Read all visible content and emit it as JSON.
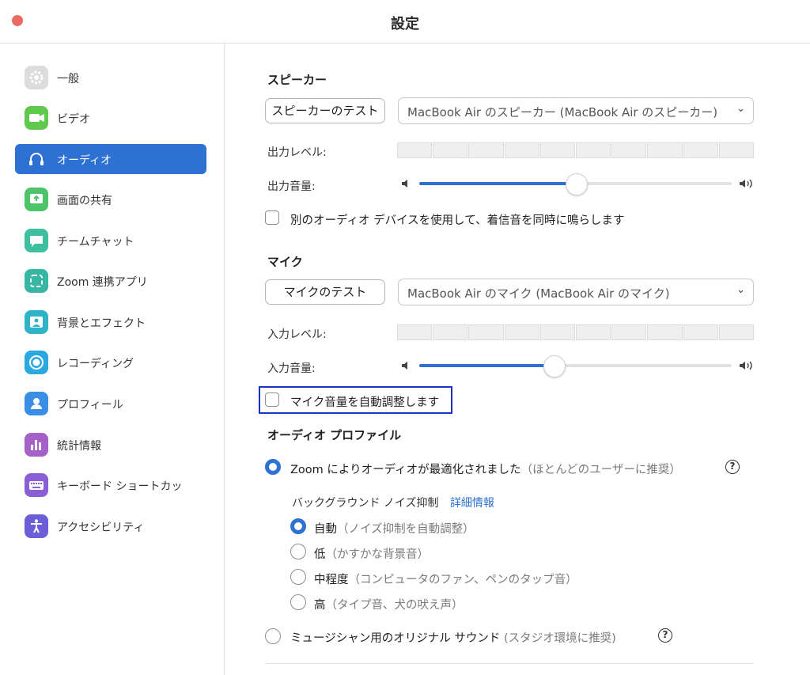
{
  "window": {
    "title": "設定"
  },
  "sidebar": {
    "items": [
      {
        "label": "一般",
        "icon": "gear-icon",
        "color": "#dcdcdc",
        "active": false
      },
      {
        "label": "ビデオ",
        "icon": "video-camera-icon",
        "color": "#5fc94d",
        "active": false
      },
      {
        "label": "オーディオ",
        "icon": "headphones-icon",
        "color": "#2d71d2",
        "active": true
      },
      {
        "label": "画面の共有",
        "icon": "screen-share-icon",
        "color": "#4ec46a",
        "active": false
      },
      {
        "label": "チームチャット",
        "icon": "chat-bubble-icon",
        "color": "#3dbfa0",
        "active": false
      },
      {
        "label": "Zoom 連携アプリ",
        "icon": "apps-icon",
        "color": "#36b6a3",
        "active": false
      },
      {
        "label": "背景とエフェクト",
        "icon": "background-icon",
        "color": "#2fb3c9",
        "active": false
      },
      {
        "label": "レコーディング",
        "icon": "record-icon",
        "color": "#2aa8e0",
        "active": false
      },
      {
        "label": "プロフィール",
        "icon": "person-icon",
        "color": "#3a8ee6",
        "active": false
      },
      {
        "label": "統計情報",
        "icon": "bar-chart-icon",
        "color": "#a561c9",
        "active": false
      },
      {
        "label": "キーボード ショートカッ",
        "icon": "keyboard-icon",
        "color": "#8a5fd6",
        "active": false
      },
      {
        "label": "アクセシビリティ",
        "icon": "accessibility-icon",
        "color": "#6a5fd6",
        "active": false
      }
    ]
  },
  "speaker": {
    "heading": "スピーカー",
    "test_button": "スピーカーのテスト",
    "device": "MacBook Air のスピーカー (MacBook Air のスピーカー)",
    "level_label": "出力レベル:",
    "volume_label": "出力音量:",
    "volume_level": 0.5
  },
  "ringtone_checkbox": {
    "label": "別のオーディオ デバイスを使用して、着信音を同時に鳴らします",
    "checked": false
  },
  "mic": {
    "heading": "マイク",
    "test_button": "マイクのテスト",
    "device": "MacBook Air のマイク (MacBook Air のマイク)",
    "level_label": "入力レベル:",
    "volume_label": "入力音量:",
    "volume_level": 0.43
  },
  "auto_adjust_checkbox": {
    "label": "マイク音量を自動調整します",
    "checked": false
  },
  "profile": {
    "heading": "オーディオ プロファイル",
    "zoom_option": "Zoom によりオーディオが最適化されました",
    "zoom_option_note": "（ほとんどのユーザーに推奨）",
    "noise_label": "バックグラウンド ノイズ抑制",
    "details_link": "詳細情報",
    "noise_options": [
      {
        "label": "自動",
        "note": "（ノイズ抑制を自動調整）",
        "selected": true
      },
      {
        "label": "低",
        "note": "（かすかな背景音）",
        "selected": false
      },
      {
        "label": "中程度",
        "note": "（コンピュータのファン、ペンのタップ音）",
        "selected": false
      },
      {
        "label": "高",
        "note": "（タイプ音、犬の吠え声）",
        "selected": false
      }
    ],
    "musician_option": "ミュージシャン用のオリジナル サウンド",
    "musician_option_note": "(スタジオ環境に推奨)",
    "help_glyph": "?"
  },
  "colors": {
    "accent": "#2d71d2",
    "highlight_box": "#1b34c6",
    "close_button": "#ec6a5e"
  }
}
